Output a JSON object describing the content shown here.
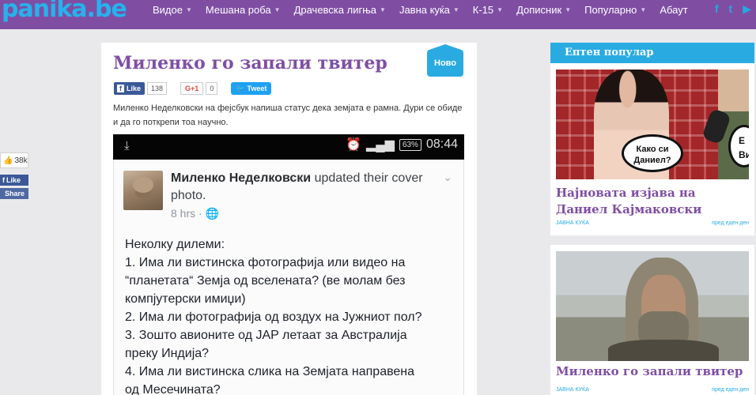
{
  "site": {
    "logo": "panika.be"
  },
  "nav": {
    "items": [
      {
        "label": "Видое",
        "caret": true
      },
      {
        "label": "Мешана роба",
        "caret": true
      },
      {
        "label": "Драчевска лигња",
        "caret": true
      },
      {
        "label": "Јавна куќа",
        "caret": true
      },
      {
        "label": "К-15",
        "caret": true
      },
      {
        "label": "Дописник",
        "caret": true
      },
      {
        "label": "Популарно",
        "caret": true
      },
      {
        "label": "Абаут",
        "caret": false
      }
    ],
    "social": [
      "f",
      "t",
      "y"
    ]
  },
  "sharebar": {
    "count": "38k",
    "like": "Like",
    "share": "Share"
  },
  "article": {
    "title": "Миленко го запали твитер",
    "badge": "Ново",
    "fb_like": "Like",
    "fb_count": "138",
    "gplus": "G+1",
    "gplus_count": "0",
    "tweet": "Tweet",
    "lead": "Миленко Неделковски на фејсбук напиша статус дека земјата е рамна. Дури се обиде и да го поткрепи тоа научно.",
    "phone": {
      "battery": "63%",
      "clock": "08:44",
      "author": "Миленко Неделковски",
      "action": "updated their cover photo.",
      "time": "8 hrs · ",
      "body_lines": [
        "Неколку дилеми:",
        "1. Има ли вистинска фотографија или видео на",
        "“планетата“ Земја од вселената? (ве молам без",
        "компјутерски имиџи)",
        "2. Има ли фотографија од воздух на Јужниот пол?",
        "3. Зошто авионите од JAP летаат за Австралија",
        "преку Индија?",
        "4. Има ли вистинска слика на Земјата направена",
        "од Месечината?"
      ]
    }
  },
  "sidebar": {
    "header": "Ептен популар",
    "cards": [
      {
        "title": "Најновата изјава на Даниел Кајмаковски",
        "bubble1": "Како си Даниел?",
        "bubble2": "Е Ви",
        "category": "ЈАВНА КУЌА",
        "time": "пред еден ден"
      },
      {
        "title": "Миленко го запали твитер",
        "category": "ЈАВНА КУЌА",
        "time": "пред еден ден"
      }
    ]
  },
  "colors": {
    "nav_bg": "#7f4ea3",
    "accent": "#29abe2",
    "title": "#7f4ea3"
  }
}
